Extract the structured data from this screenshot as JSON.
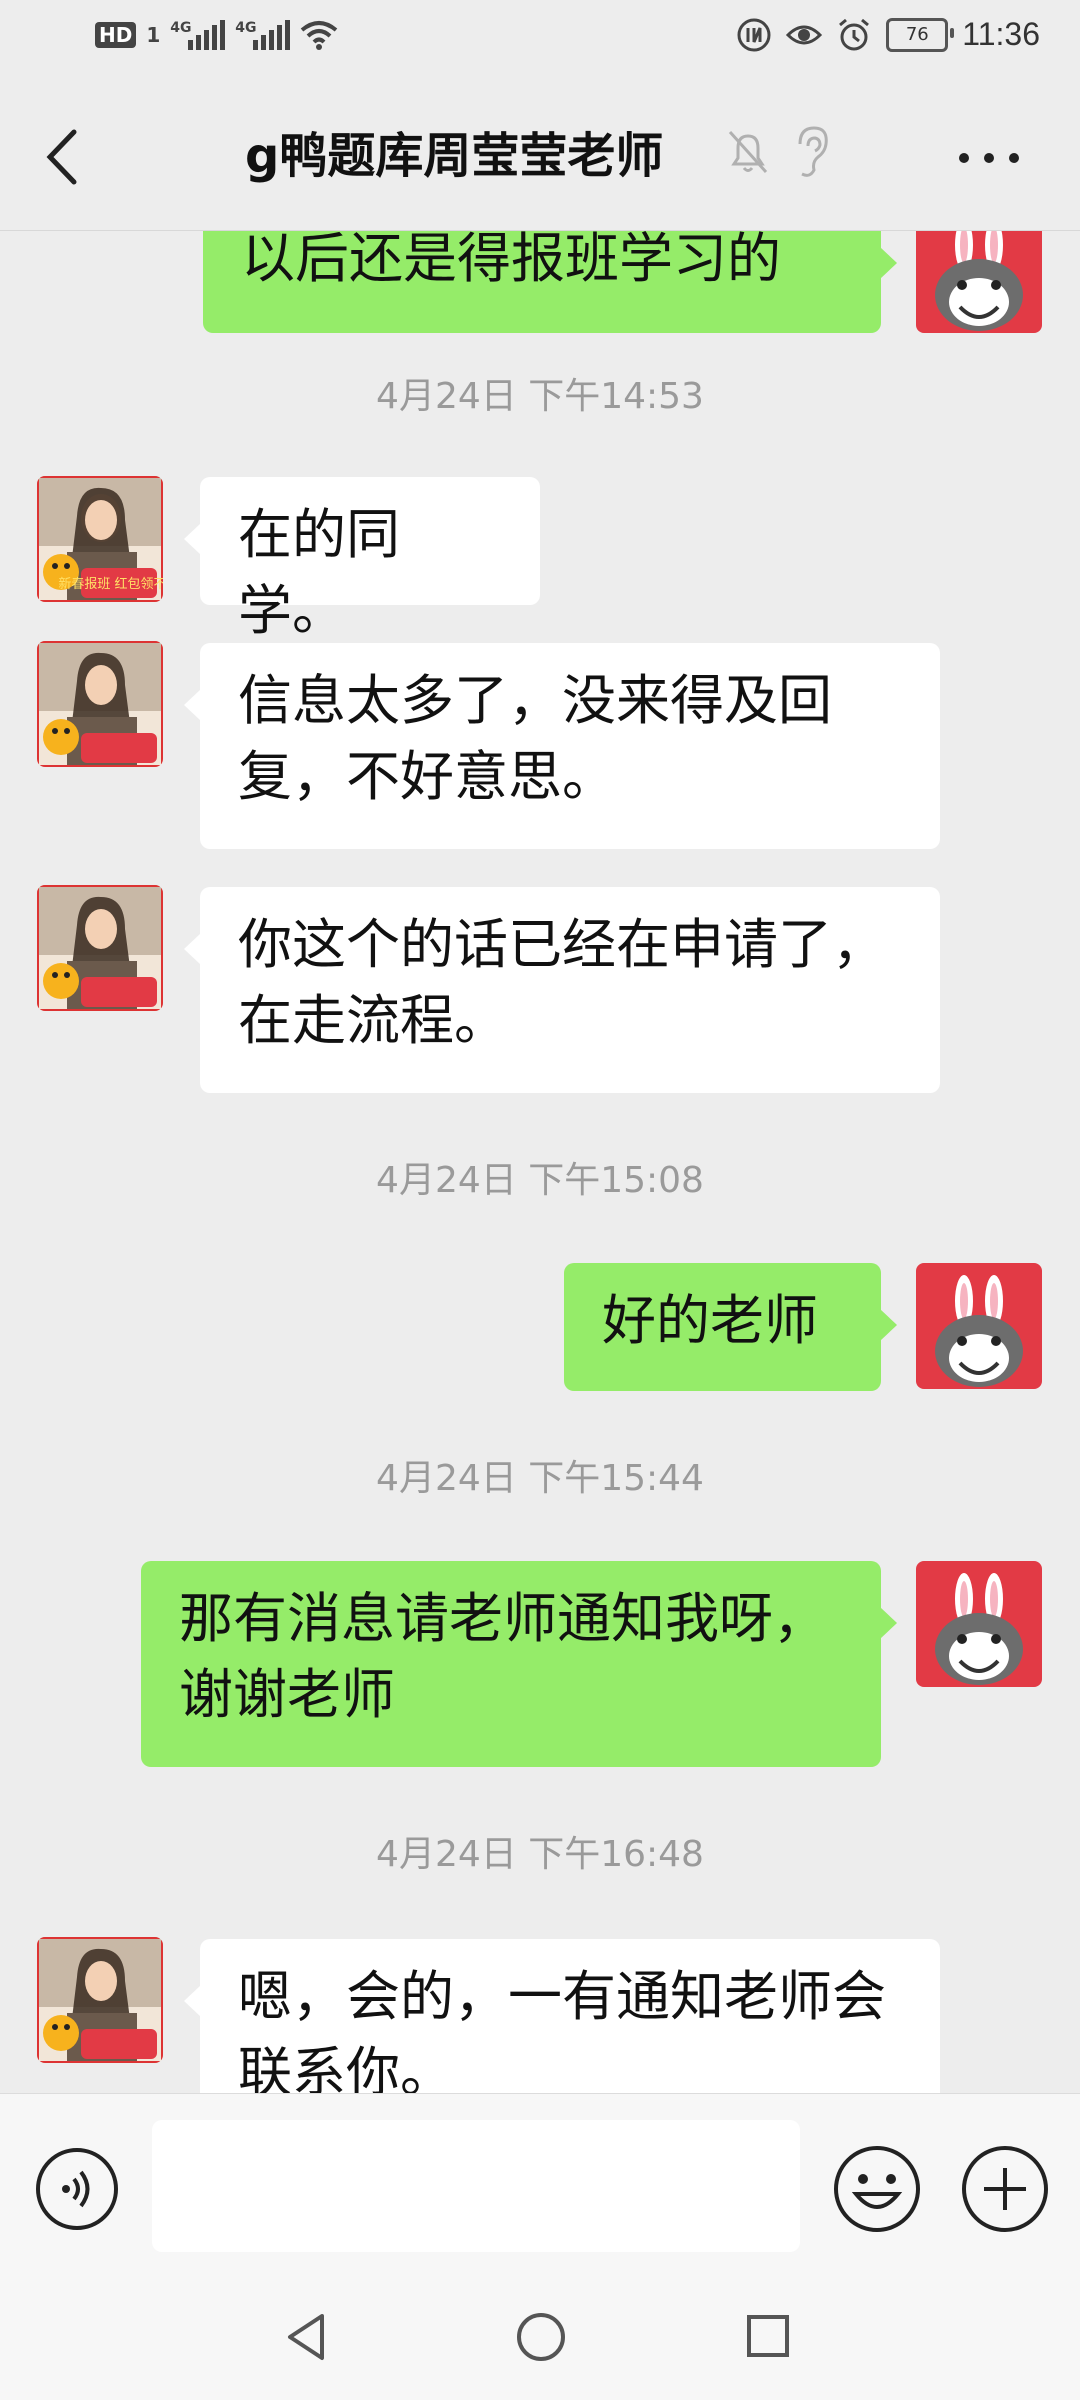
{
  "status_bar": {
    "hd_label": "HD",
    "sim_label": "1",
    "network_1": "4G",
    "network_2": "4G",
    "battery": "76",
    "time": "11:36"
  },
  "header": {
    "title": "g鸭题库周莹莹老师",
    "back_icon": "chevron-left-icon",
    "mute_icon": "bell-off-icon",
    "earpiece_icon": "ear-icon",
    "more_icon": "more-dots-icon"
  },
  "messages": [
    {
      "type": "out",
      "text": "以后还是得报班学习的"
    },
    {
      "type": "time",
      "text": "4月24日 下午14:53"
    },
    {
      "type": "in",
      "text": "在的同学。"
    },
    {
      "type": "in",
      "text": "信息太多了，没来得及回复，不好意思。"
    },
    {
      "type": "in",
      "text": "你这个的话已经在申请了，在走流程。"
    },
    {
      "type": "time",
      "text": "4月24日 下午15:08"
    },
    {
      "type": "out",
      "text": "好的老师"
    },
    {
      "type": "time",
      "text": "4月24日 下午15:44"
    },
    {
      "type": "out",
      "text": "那有消息请老师通知我呀，谢谢老师"
    },
    {
      "type": "time",
      "text": "4月24日 下午16:48"
    },
    {
      "type": "in",
      "text": "嗯，会的，一有通知老师会联系你。"
    }
  ],
  "teacher_avatar_caption": "新春报班 红包领不停",
  "input_bar": {
    "voice_icon": "voice-icon",
    "emoji_icon": "emoji-icon",
    "plus_icon": "plus-icon",
    "input_value": ""
  },
  "nav_bar": {
    "back_icon": "triangle-back-icon",
    "home_icon": "circle-home-icon",
    "recent_icon": "square-recent-icon"
  },
  "colors": {
    "background": "#ededed",
    "bubble_out": "#95ec69",
    "bubble_in": "#ffffff",
    "timestamp": "#9a9a9a"
  }
}
